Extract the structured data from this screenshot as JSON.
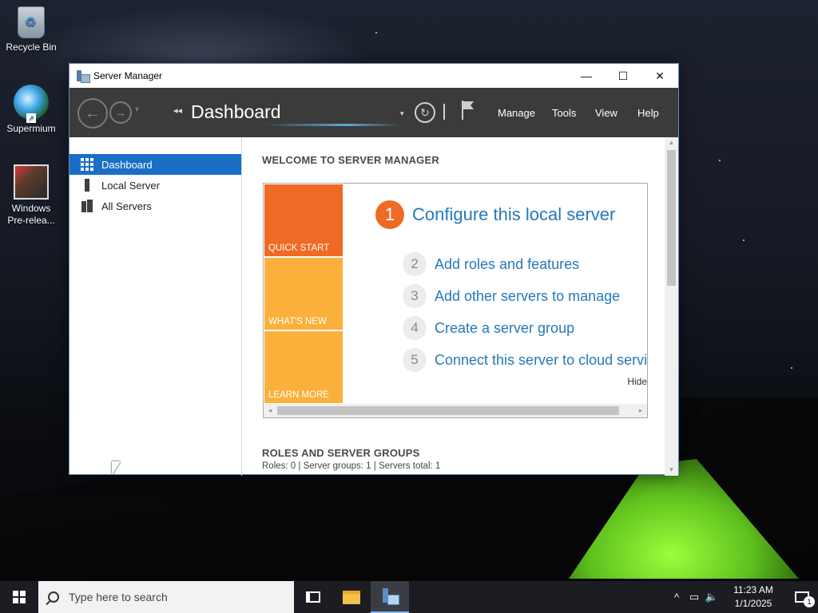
{
  "desktop": {
    "icons": [
      {
        "label": "Recycle Bin",
        "icon": "recycle-bin-icon"
      },
      {
        "label": "Supermium",
        "icon": "supermium-browser-icon"
      },
      {
        "label": "Windows Pre-relea...",
        "icon": "windows-prerelease-icon"
      }
    ]
  },
  "window": {
    "title": "Server Manager",
    "controls": {
      "minimize": "—",
      "maximize": "☐",
      "close": "✕"
    },
    "toolbar": {
      "back": "←",
      "forward": "→",
      "breadcrumb_arrows": "◂◂",
      "breadcrumb": "Dashboard",
      "dropdown": "▾",
      "refresh": "↻",
      "menus": [
        "Manage",
        "Tools",
        "View",
        "Help"
      ]
    },
    "sidebar": {
      "items": [
        {
          "label": "Dashboard",
          "icon": "dashboard-grid-icon",
          "active": true
        },
        {
          "label": "Local Server",
          "icon": "local-server-icon",
          "active": false
        },
        {
          "label": "All Servers",
          "icon": "all-servers-icon",
          "active": false
        }
      ]
    },
    "main": {
      "welcome_heading": "WELCOME TO SERVER MANAGER",
      "tiles": [
        "QUICK START",
        "WHAT'S NEW",
        "LEARN MORE"
      ],
      "step1": {
        "number": "1",
        "label": "Configure this local server"
      },
      "steps": [
        {
          "number": "2",
          "label": "Add roles and features"
        },
        {
          "number": "3",
          "label": "Add other servers to manage"
        },
        {
          "number": "4",
          "label": "Create a server group"
        },
        {
          "number": "5",
          "label": "Connect this server to cloud servic"
        }
      ],
      "hide_link": "Hide",
      "roles_heading": "ROLES AND SERVER GROUPS",
      "roles_summary": "Roles: 0   |   Server groups: 1   |   Servers total: 1"
    }
  },
  "taskbar": {
    "search_placeholder": "Type here to search",
    "clock_time": "11:23 AM",
    "clock_date": "1/1/2025",
    "tray_chevron": "^",
    "notification_count": "1"
  },
  "colors": {
    "accent_blue": "#1a6ec6",
    "link_blue": "#2579b9",
    "quickstart_orange": "#ef6a25",
    "tile_yellow": "#fbb03b",
    "toolbar_dark": "#3b3b3b"
  }
}
